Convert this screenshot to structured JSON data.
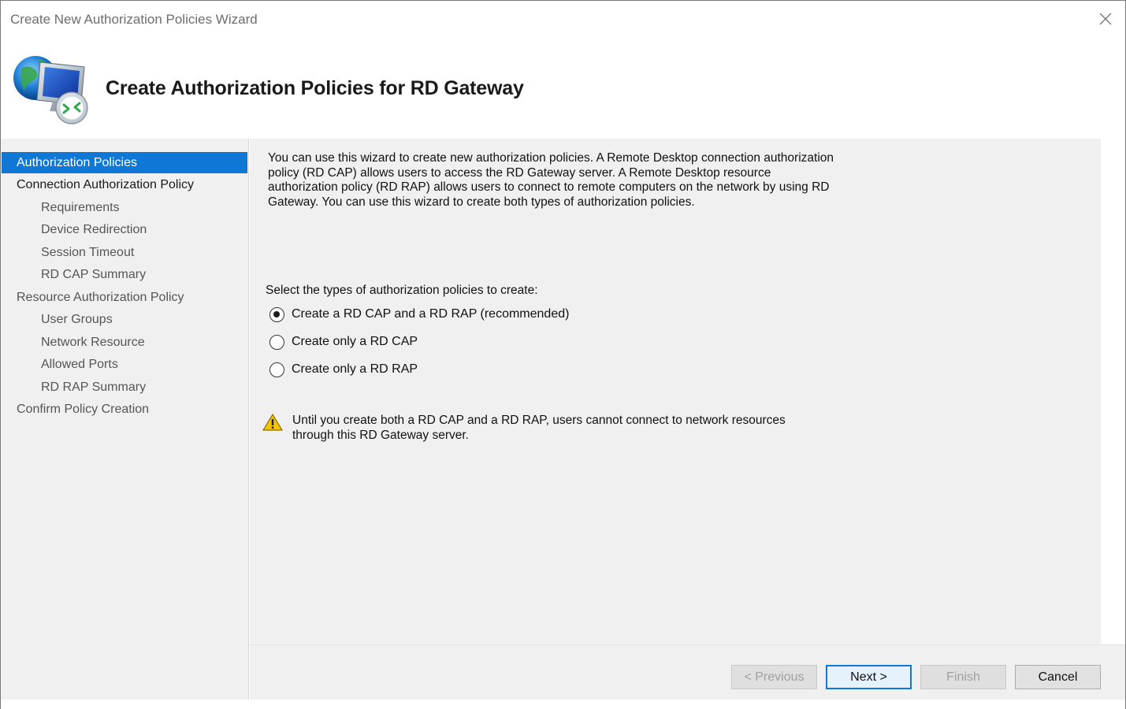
{
  "window": {
    "title": "Create New Authorization Policies Wizard"
  },
  "header": {
    "heading": "Create Authorization Policies for RD Gateway",
    "icon": "rd-gateway-icon"
  },
  "sidebar": {
    "items": [
      {
        "label": "Authorization Policies",
        "level": 0,
        "active": true
      },
      {
        "label": "Connection Authorization Policy",
        "level": 0,
        "active": false
      },
      {
        "label": "Requirements",
        "level": 1,
        "active": false
      },
      {
        "label": "Device Redirection",
        "level": 1,
        "active": false
      },
      {
        "label": "Session Timeout",
        "level": 1,
        "active": false
      },
      {
        "label": "RD CAP Summary",
        "level": 1,
        "active": false
      },
      {
        "label": "Resource Authorization Policy",
        "level": 0,
        "active": false
      },
      {
        "label": "User Groups",
        "level": 1,
        "active": false
      },
      {
        "label": "Network Resource",
        "level": 1,
        "active": false
      },
      {
        "label": "Allowed Ports",
        "level": 1,
        "active": false
      },
      {
        "label": "RD RAP Summary",
        "level": 1,
        "active": false
      },
      {
        "label": "Confirm Policy Creation",
        "level": 0,
        "active": false
      }
    ]
  },
  "main": {
    "intro": "You can use this wizard to create new authorization policies. A Remote Desktop connection authorization policy (RD CAP) allows users to access the RD Gateway server. A Remote Desktop resource authorization policy (RD RAP) allows users to connect to remote computers on the network by using RD Gateway. You can use this wizard to create both types of authorization policies.",
    "prompt": "Select the types of authorization policies to create:",
    "options": [
      {
        "label": "Create a RD CAP and a RD RAP (recommended)",
        "checked": true
      },
      {
        "label": "Create only a RD CAP",
        "checked": false
      },
      {
        "label": "Create only a RD RAP",
        "checked": false
      }
    ],
    "warning": "Until you create both a RD CAP and a RD RAP, users cannot connect to network resources through this RD Gateway server."
  },
  "buttons": {
    "previous": "< Previous",
    "next": "Next >",
    "finish": "Finish",
    "cancel": "Cancel"
  },
  "colors": {
    "accent": "#0f78d7",
    "panel": "#f0f0f0",
    "warning": "#f5c400"
  }
}
